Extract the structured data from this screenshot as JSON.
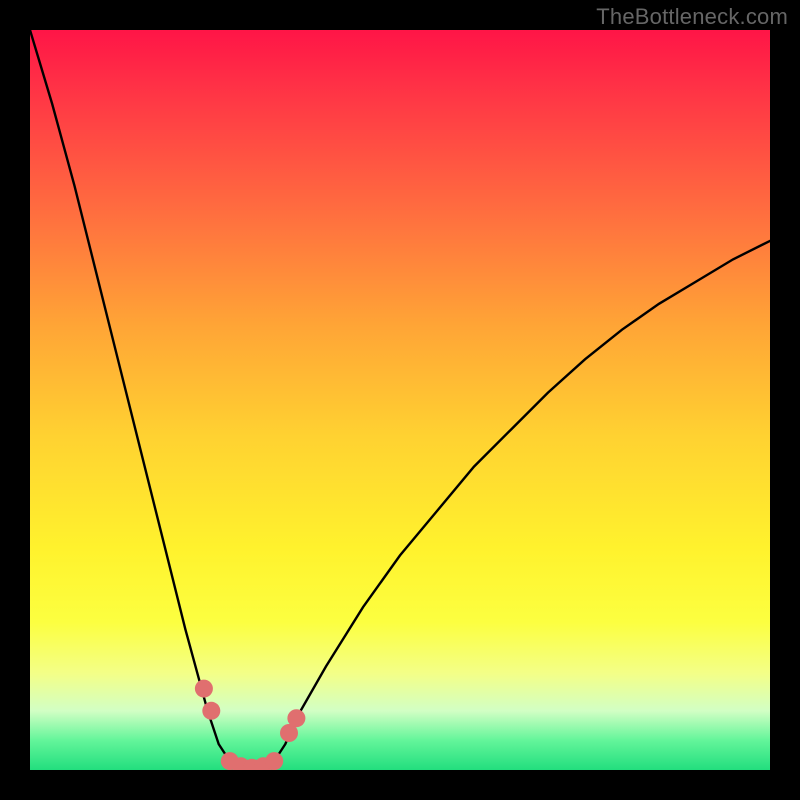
{
  "watermark": "TheBottleneck.com",
  "chart_data": {
    "type": "line",
    "title": "",
    "xlabel": "",
    "ylabel": "",
    "ylim": [
      0,
      100
    ],
    "x": [
      0.0,
      0.03,
      0.06,
      0.09,
      0.12,
      0.15,
      0.18,
      0.21,
      0.24,
      0.255,
      0.27,
      0.285,
      0.3,
      0.315,
      0.33,
      0.345,
      0.36,
      0.4,
      0.45,
      0.5,
      0.55,
      0.6,
      0.65,
      0.7,
      0.75,
      0.8,
      0.85,
      0.9,
      0.95,
      1.0
    ],
    "values": [
      100,
      90,
      79,
      67,
      55,
      43,
      31,
      19,
      8,
      3.5,
      1.2,
      0.5,
      0.3,
      0.5,
      1.2,
      3.5,
      7,
      14,
      22,
      29,
      35,
      41,
      46,
      51,
      55.5,
      59.5,
      63,
      66,
      69,
      71.5
    ],
    "markers": {
      "x": [
        0.235,
        0.245,
        0.27,
        0.285,
        0.3,
        0.315,
        0.33,
        0.35,
        0.36
      ],
      "values": [
        11,
        8,
        1.2,
        0.5,
        0.3,
        0.5,
        1.2,
        5,
        7
      ]
    },
    "gradient_stops": [
      {
        "pos": 0.0,
        "color": "#ff1547"
      },
      {
        "pos": 0.7,
        "color": "#fff22d"
      },
      {
        "pos": 1.0,
        "color": "#22de7e"
      }
    ]
  }
}
